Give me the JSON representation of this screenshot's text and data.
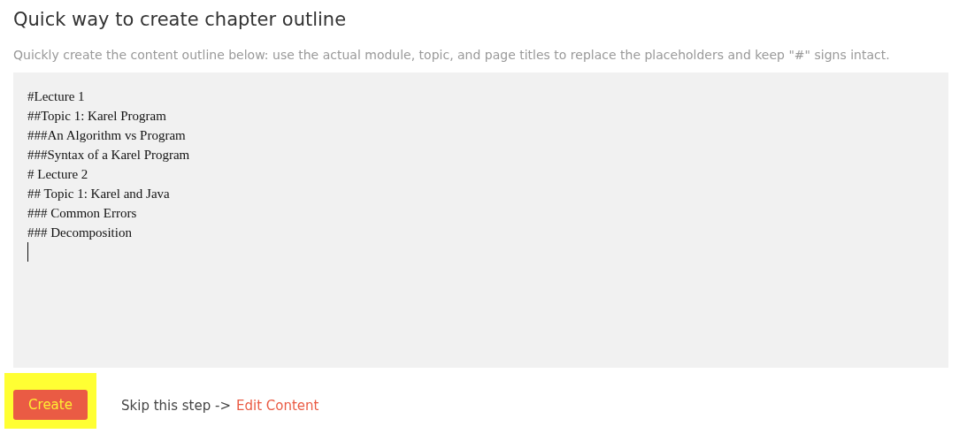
{
  "title": "Quick way to create chapter outline",
  "description": "Quickly create the content outline below: use the actual module, topic, and page titles to replace the placeholders and keep \"#\" signs intact.",
  "outline_field": {
    "value": "#Lecture 1\n##Topic 1: Karel Program\n###An Algorithm vs Program\n###Syntax of a Karel Program\n# Lecture 2\n## Topic 1: Karel and Java\n### Common Errors\n### Decomposition\n",
    "focused": true
  },
  "create_button": {
    "label": "Create",
    "highlighted": true
  },
  "skip_text": "Skip this step ->",
  "skip_link": "Edit Content"
}
